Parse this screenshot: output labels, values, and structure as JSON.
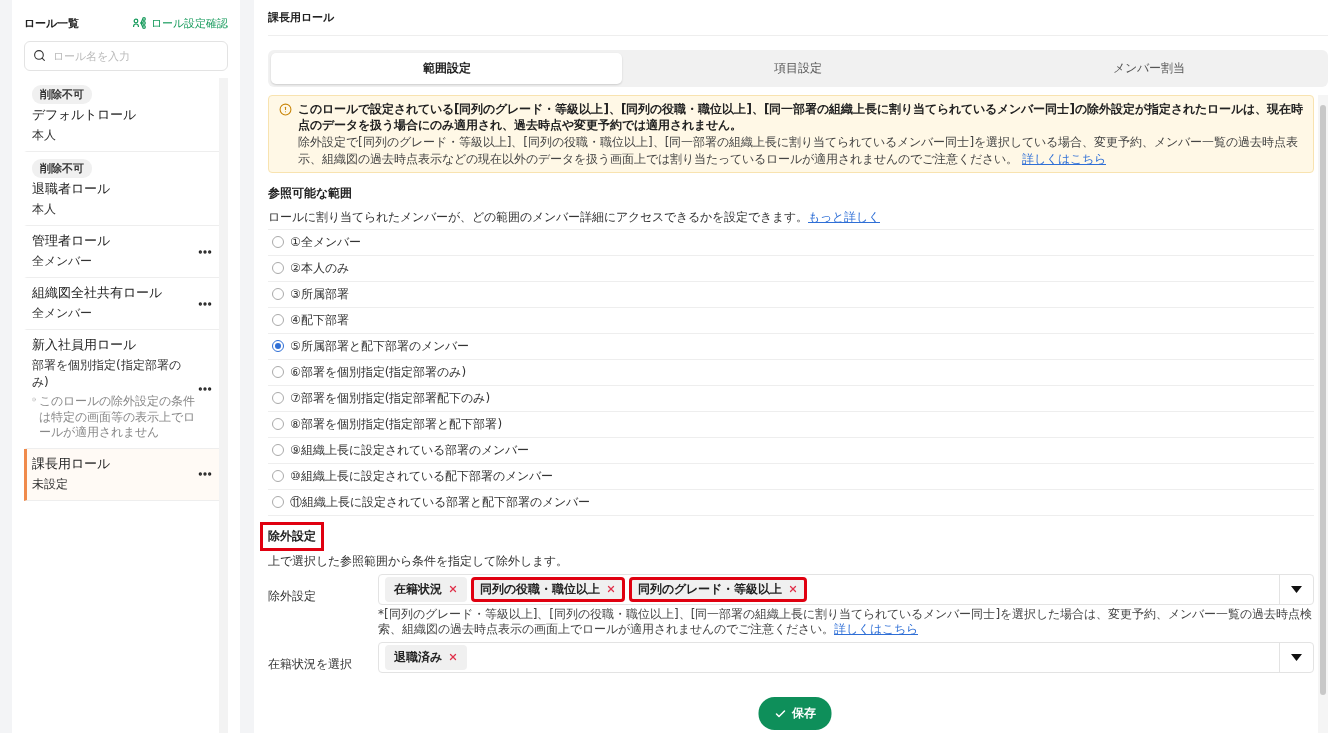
{
  "sidebar": {
    "title": "ロール一覧",
    "action": "ロール設定確認",
    "search": {
      "placeholder": "ロール名を入力"
    },
    "items": [
      {
        "badge": "削除不可",
        "name": "デフォルトロール",
        "scope": "本人",
        "has_menu": false,
        "selected": false
      },
      {
        "badge": "削除不可",
        "name": "退職者ロール",
        "scope": "本人",
        "has_menu": false,
        "selected": false
      },
      {
        "name": "管理者ロール",
        "scope": "全メンバー",
        "has_menu": true,
        "selected": false
      },
      {
        "name": "組織図全社共有ロール",
        "scope": "全メンバー",
        "has_menu": true,
        "selected": false
      },
      {
        "name": "新入社員用ロール",
        "scope": "部署を個別指定(指定部署のみ)",
        "note": "このロールの除外設定の条件は特定の画面等の表示上でロールが適用されません",
        "has_menu": true,
        "selected": false
      },
      {
        "name": "課長用ロール",
        "scope": "未設定",
        "has_menu": true,
        "selected": true
      }
    ]
  },
  "main": {
    "title": "課長用ロール",
    "tabs": [
      {
        "label": "範囲設定",
        "selected": true
      },
      {
        "label": "項目設定",
        "selected": false
      },
      {
        "label": "メンバー割当",
        "selected": false
      }
    ],
    "alert": {
      "title": "このロールで設定されている[同列のグレード・等級以上]、[同列の役職・職位以上]、[同一部署の組織上長に割り当てられているメンバー同士]の除外設定が指定されたロールは、現在時点のデータを扱う場合にのみ適用され、過去時点や変更予約では適用されません。",
      "body": "除外設定で[同列のグレード・等級以上]、[同列の役職・職位以上]、[同一部署の組織上長に割り当てられているメンバー同士]を選択している場合、変更予約、メンバー一覧の過去時点表示、組織図の過去時点表示などの現在以外のデータを扱う画面上では割り当たっているロールが適用されませんのでご注意ください。",
      "link": "詳しくはこちら"
    },
    "scope": {
      "heading": "参照可能な範囲",
      "description": "ロールに割り当てられたメンバーが、どの範囲のメンバー詳細にアクセスできるかを設定できます。",
      "link": "もっと詳しく",
      "options": [
        {
          "label": "①全メンバー",
          "selected": false
        },
        {
          "label": "②本人のみ",
          "selected": false
        },
        {
          "label": "③所属部署",
          "selected": false
        },
        {
          "label": "④配下部署",
          "selected": false
        },
        {
          "label": "⑤所属部署と配下部署のメンバー",
          "selected": true
        },
        {
          "label": "⑥部署を個別指定(指定部署のみ)",
          "selected": false
        },
        {
          "label": "⑦部署を個別指定(指定部署配下のみ)",
          "selected": false
        },
        {
          "label": "⑧部署を個別指定(指定部署と配下部署)",
          "selected": false
        },
        {
          "label": "⑨組織上長に設定されている部署のメンバー",
          "selected": false
        },
        {
          "label": "⑩組織上長に設定されている配下部署のメンバー",
          "selected": false
        },
        {
          "label": "⑪組織上長に設定されている部署と配下部署のメンバー",
          "selected": false
        }
      ]
    },
    "exclusion": {
      "heading": "除外設定",
      "highlighted": true,
      "description": "上で選択した参照範囲から条件を指定して除外します。",
      "fields": [
        {
          "label": "除外設定",
          "chips": [
            {
              "label": "在籍状況",
              "highlighted": false
            },
            {
              "label": "同列の役職・職位以上",
              "highlighted": true
            },
            {
              "label": "同列のグレード・等級以上",
              "highlighted": true
            }
          ],
          "note": "*[同列のグレード・等級以上]、[同列の役職・職位以上]、[同一部署の組織上長に割り当てられているメンバー同士]を選択した場合は、変更予約、メンバー一覧の過去時点検索、組織図の過去時点表示の画面上でロールが適用されませんのでご注意ください。",
          "link": "詳しくはこちら"
        },
        {
          "label": "在籍状況を選択",
          "chips": [
            {
              "label": "退職済み",
              "highlighted": false
            }
          ]
        }
      ]
    }
  },
  "save_button": "保存"
}
